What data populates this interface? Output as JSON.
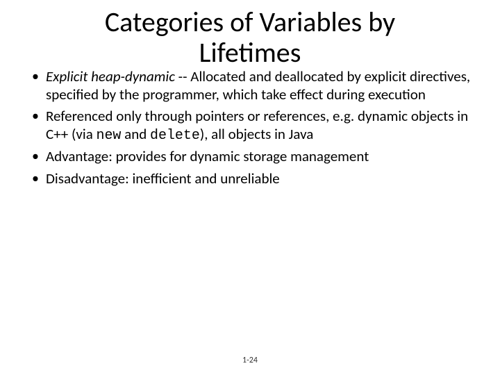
{
  "title_line1": "Categories of Variables by",
  "title_line2": "Lifetimes",
  "bullets": {
    "b1": {
      "term": "Explicit heap-dynamic",
      "rest": " -- Allocated and deallocated by explicit directives, specified by the programmer, which take effect during execution"
    },
    "b2": {
      "pre": "Referenced only through pointers or references, e.g. dynamic objects in C++ (via ",
      "code1": "new",
      "mid": " and ",
      "code2": "delete",
      "post": "), all objects in Java"
    },
    "b3": "Advantage: provides for dynamic storage management",
    "b4": "Disadvantage: inefficient and unreliable"
  },
  "footer": "1-24"
}
